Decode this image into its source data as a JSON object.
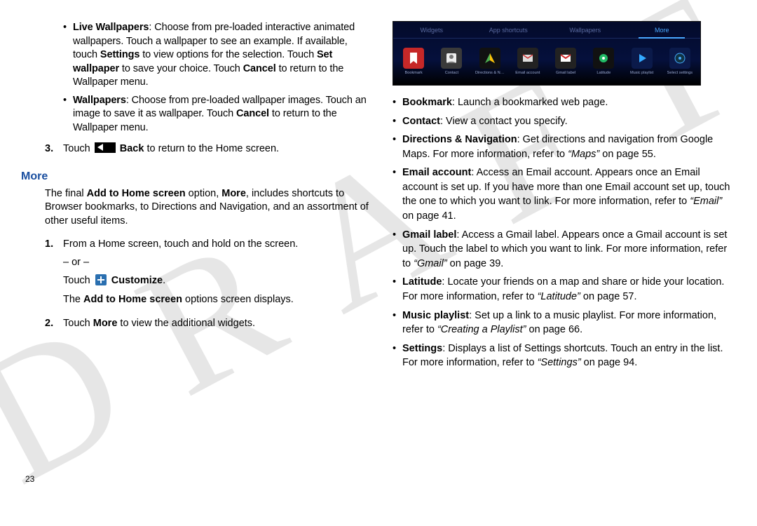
{
  "watermark": "DRAFT",
  "page_number": "23",
  "left": {
    "bullets": [
      {
        "segments": [
          {
            "t": "Live Wallpapers",
            "b": true
          },
          {
            "t": ": Choose from pre-loaded interactive animated wallpapers. Touch a wallpaper to see an example. If available, touch "
          },
          {
            "t": "Settings",
            "b": true
          },
          {
            "t": " to view options for the selection. Touch "
          },
          {
            "t": "Set wallpaper",
            "b": true
          },
          {
            "t": " to save your choice. Touch "
          },
          {
            "t": "Cancel",
            "b": true
          },
          {
            "t": " to return to the Wallpaper menu."
          }
        ]
      },
      {
        "segments": [
          {
            "t": "Wallpapers",
            "b": true
          },
          {
            "t": ": Choose from pre-loaded wallpaper images. Touch an image to save it as wallpaper. Touch "
          },
          {
            "t": "Cancel",
            "b": true
          },
          {
            "t": " to return to the Wallpaper menu."
          }
        ]
      }
    ],
    "step3": {
      "num": "3.",
      "segments": [
        {
          "t": "Touch "
        },
        {
          "icon": "back"
        },
        {
          "t": " "
        },
        {
          "t": "Back",
          "b": true
        },
        {
          "t": " to return to the Home screen."
        }
      ]
    },
    "more_heading": "More",
    "intro_segments": [
      {
        "t": "The final "
      },
      {
        "t": "Add to Home screen",
        "b": true
      },
      {
        "t": " option, "
      },
      {
        "t": "More",
        "b": true
      },
      {
        "t": ", includes shortcuts to Browser bookmarks, to Directions and Navigation, and an assortment of other useful items."
      }
    ],
    "steps": [
      {
        "num": "1.",
        "lines": [
          [
            {
              "t": "From a Home screen, touch and hold on the screen."
            }
          ],
          [
            {
              "t": "– or –"
            }
          ],
          [
            {
              "t": "Touch "
            },
            {
              "icon": "plus"
            },
            {
              "t": " "
            },
            {
              "t": "Customize",
              "b": true
            },
            {
              "t": "."
            }
          ],
          [
            {
              "t": "The "
            },
            {
              "t": "Add to Home screen",
              "b": true
            },
            {
              "t": " options screen displays."
            }
          ]
        ]
      },
      {
        "num": "2.",
        "lines": [
          [
            {
              "t": "Touch "
            },
            {
              "t": "More",
              "b": true
            },
            {
              "t": " to view the additional widgets."
            }
          ]
        ]
      }
    ]
  },
  "right": {
    "tabs": [
      "Widgets",
      "App shortcuts",
      "Wallpapers",
      "More"
    ],
    "active_tab": 3,
    "icons": [
      {
        "name": "Bookmark",
        "cls": "ic-bookmark"
      },
      {
        "name": "Contact",
        "cls": "ic-contact"
      },
      {
        "name": "Directions & N…",
        "cls": "ic-dir"
      },
      {
        "name": "Email account",
        "cls": "ic-email"
      },
      {
        "name": "Gmail label",
        "cls": "ic-gmail"
      },
      {
        "name": "Latitude",
        "cls": "ic-lat"
      },
      {
        "name": "Music playlist",
        "cls": "ic-music"
      },
      {
        "name": "Select settings",
        "cls": "ic-settings"
      }
    ],
    "features": [
      {
        "segments": [
          {
            "t": "Bookmark",
            "b": true
          },
          {
            "t": ": Launch a bookmarked web page."
          }
        ]
      },
      {
        "segments": [
          {
            "t": "Contact",
            "b": true
          },
          {
            "t": ": View a contact you specify."
          }
        ]
      },
      {
        "segments": [
          {
            "t": "Directions & Navigation",
            "b": true
          },
          {
            "t": ": Get directions and navigation from Google Maps. For more information, refer to "
          },
          {
            "t": "“Maps”",
            "i": true
          },
          {
            "t": "  on page 55."
          }
        ]
      },
      {
        "segments": [
          {
            "t": "Email account",
            "b": true
          },
          {
            "t": ": Access an Email account. Appears once an Email account is set up. If you have more than one Email account set up, touch the one to which you want to link. For more information, refer to "
          },
          {
            "t": "“Email”",
            "i": true
          },
          {
            "t": "  on page 41."
          }
        ]
      },
      {
        "segments": [
          {
            "t": "Gmail label",
            "b": true
          },
          {
            "t": ": Access a Gmail label. Appears once a Gmail account is set up. Touch the label to which you want to link. For more information, refer to "
          },
          {
            "t": "“Gmail”",
            "i": true
          },
          {
            "t": "  on page 39."
          }
        ]
      },
      {
        "segments": [
          {
            "t": "Latitude",
            "b": true
          },
          {
            "t": ": Locate your friends on a map and share or hide your location. For more information, refer to "
          },
          {
            "t": "“Latitude”",
            "i": true
          },
          {
            "t": "  on page 57."
          }
        ]
      },
      {
        "segments": [
          {
            "t": "Music playlist",
            "b": true
          },
          {
            "t": ": Set up a link to a music playlist. For more information, refer to "
          },
          {
            "t": "“Creating a Playlist”",
            "i": true
          },
          {
            "t": "  on page 66."
          }
        ]
      },
      {
        "segments": [
          {
            "t": "Settings",
            "b": true
          },
          {
            "t": ": Displays a list of Settings shortcuts. Touch an entry in the list. For more information, refer to "
          },
          {
            "t": "“Settings”",
            "i": true
          },
          {
            "t": "  on page 94."
          }
        ]
      }
    ]
  }
}
